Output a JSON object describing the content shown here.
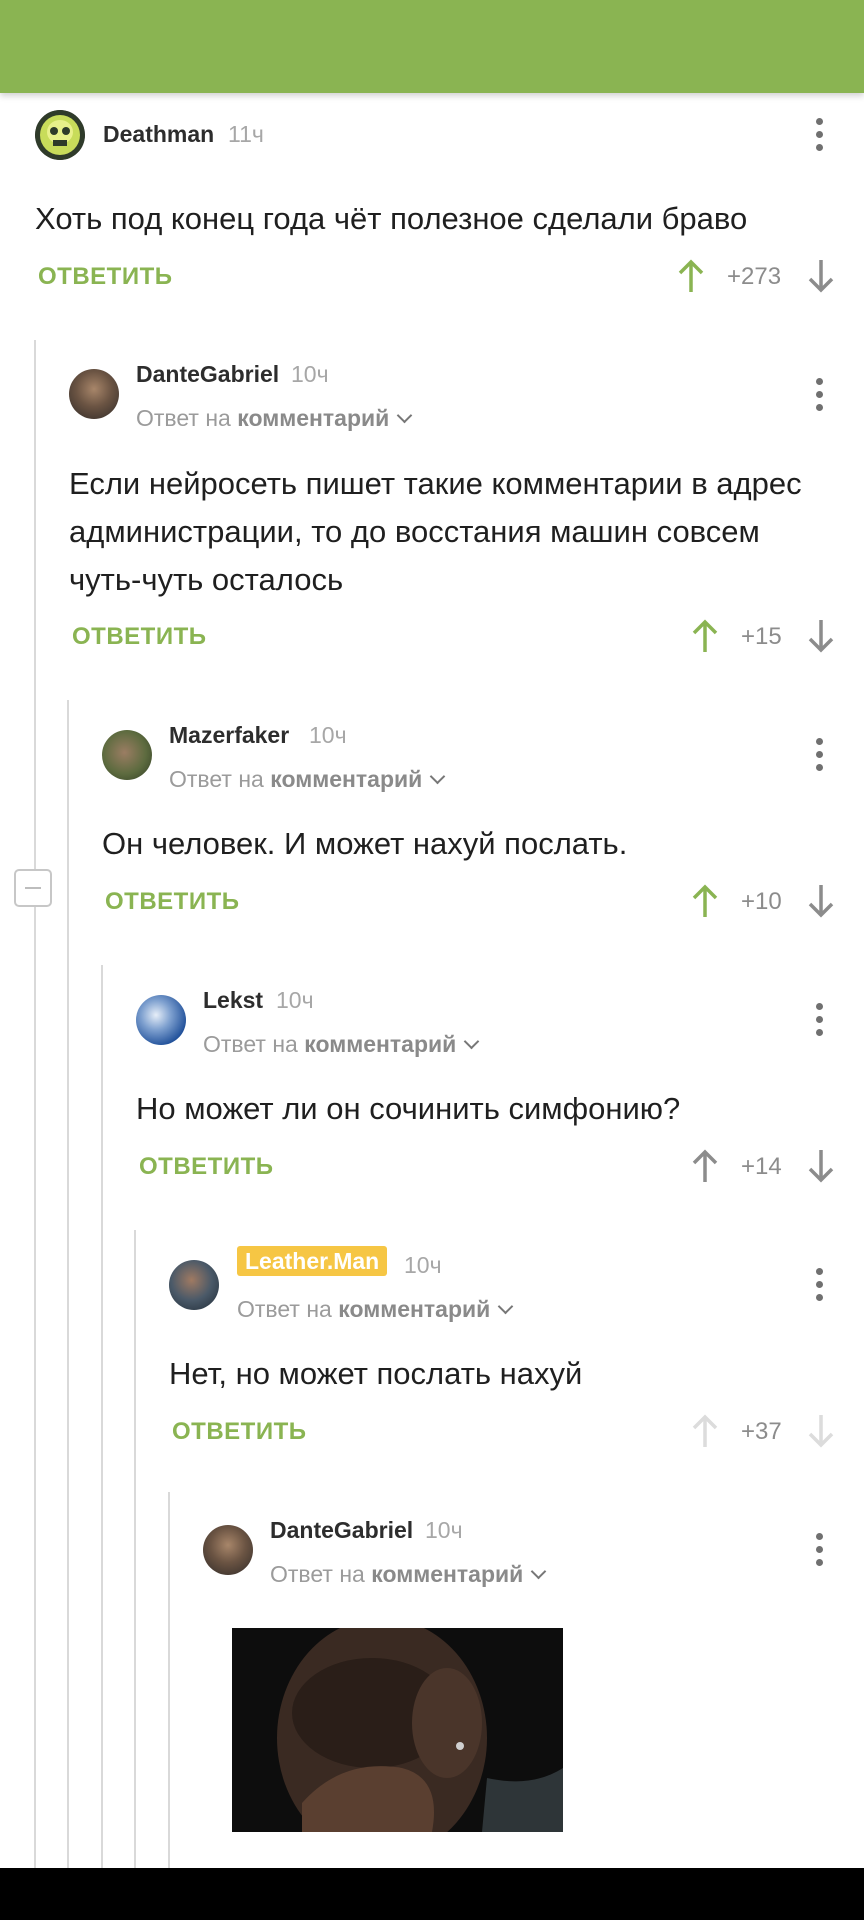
{
  "colors": {
    "accent": "#8ab452",
    "badge": "#f6c644"
  },
  "comments": [
    {
      "username": "Deathman",
      "time": "11ч",
      "text": "Хоть под конец года чёт полезное сделали браво",
      "reply": "ОТВЕТИТЬ",
      "score": "+273",
      "vote": "up-active",
      "avatar": "skull-avatar"
    },
    {
      "username": "DanteGabriel",
      "time": "10ч",
      "reply_to": "Ответ на",
      "reply_to_target": "комментарий",
      "text": "Если нейросеть пишет такие комментарии в адрес администрации, то до восстания машин совсем чуть-чуть осталось",
      "reply": "ОТВЕТИТЬ",
      "score": "+15",
      "vote": "up-active"
    },
    {
      "username": "Mazerfaker",
      "time": "10ч",
      "reply_to": "Ответ на",
      "reply_to_target": "комментарий",
      "text": "Он человек. И может нахуй послать.",
      "reply": "ОТВЕТИТЬ",
      "score": "+10",
      "vote": "up-active"
    },
    {
      "username": "Lekst",
      "time": "10ч",
      "reply_to": "Ответ на",
      "reply_to_target": "комментарий",
      "text": "Но может ли он сочинить симфонию?",
      "reply": "ОТВЕТИТЬ",
      "score": "+14",
      "vote": "neutral"
    },
    {
      "username": "Leather.Man",
      "time": "10ч",
      "reply_to": "Ответ на",
      "reply_to_target": "комментарий",
      "text": "Нет, но может послать нахуй",
      "reply": "ОТВЕТИТЬ",
      "score": "+37",
      "vote": "disabled"
    },
    {
      "username": "DanteGabriel",
      "time": "10ч",
      "reply_to": "Ответ на",
      "reply_to_target": "комментарий",
      "media": "facepalm-gif"
    }
  ]
}
